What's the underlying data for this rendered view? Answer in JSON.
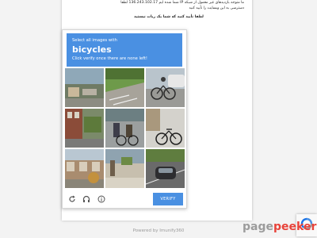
{
  "notice": {
    "line1": "ما متوجه بازدیدهای غیر معمول از شبکه IP شما شده ایم 136.243.102.17 لطفا",
    "line2": "دسترسی به این وبسایت را تأیید کنید",
    "line3": "لطفا تأیید کنید که شما یک ربات نیستید"
  },
  "captcha": {
    "instruction": "Select all images with",
    "target": "bicycles",
    "hint": "Click verify once there are none left!",
    "verify_label": "VERIFY",
    "header_color": "#4a90e2"
  },
  "footer": {
    "powered_by": "Powered by Imunify360"
  },
  "watermark": {
    "part1": "page",
    "part2": "peeker"
  },
  "icons": [
    "reload-icon",
    "headphones-icon",
    "info-icon",
    "recaptcha-logo-icon"
  ]
}
